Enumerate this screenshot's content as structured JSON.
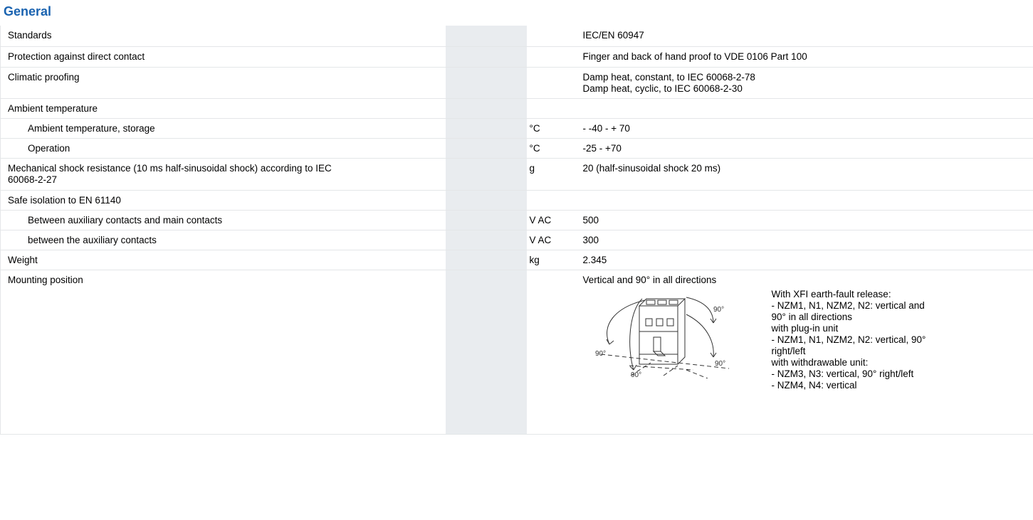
{
  "section": {
    "title": "General"
  },
  "rows": [
    {
      "label": "Standards",
      "unit": "",
      "value": "IEC/EN 60947",
      "indent": false
    },
    {
      "label": "Protection against direct contact",
      "unit": "",
      "value": "Finger and back of hand proof to VDE 0106 Part 100",
      "indent": false
    },
    {
      "label": "Climatic proofing",
      "unit": "",
      "value": "Damp heat, constant, to IEC 60068-2-78",
      "value2": "Damp heat, cyclic, to IEC 60068-2-30",
      "indent": false
    },
    {
      "label": "Ambient temperature",
      "unit": "",
      "value": "",
      "indent": false
    },
    {
      "label": "Ambient temperature, storage",
      "unit": "°C",
      "value": "- -40 - + 70",
      "indent": true
    },
    {
      "label": "Operation",
      "unit": "°C",
      "value": "-25 - +70",
      "indent": true
    },
    {
      "label": "Mechanical shock resistance (10 ms half-sinusoidal shock) according to IEC",
      "label2": "60068-2-27",
      "unit": "g",
      "value": "20 (half-sinusoidal shock 20 ms)",
      "indent": false
    },
    {
      "label": "Safe isolation to EN 61140",
      "unit": "",
      "value": "",
      "indent": false
    },
    {
      "label": "Between auxiliary contacts and main contacts",
      "unit": "V AC",
      "value": "500",
      "indent": true
    },
    {
      "label": "between the auxiliary contacts",
      "unit": "V AC",
      "value": "300",
      "indent": true
    },
    {
      "label": "Weight",
      "unit": "kg",
      "value": "2.345",
      "indent": false
    }
  ],
  "mounting": {
    "label": "Mounting position",
    "value": "Vertical and 90° in all directions",
    "angle_label": "90°",
    "notes": [
      "With XFI earth-fault release:",
      "- NZM1, N1, NZM2, N2: vertical and",
      "90° in all directions",
      "with plug-in unit",
      "- NZM1, N1, NZM2, N2: vertical, 90°",
      "right/left",
      "with withdrawable unit:",
      "- NZM3, N3: vertical, 90° right/left",
      "- NZM4, N4: vertical"
    ]
  }
}
